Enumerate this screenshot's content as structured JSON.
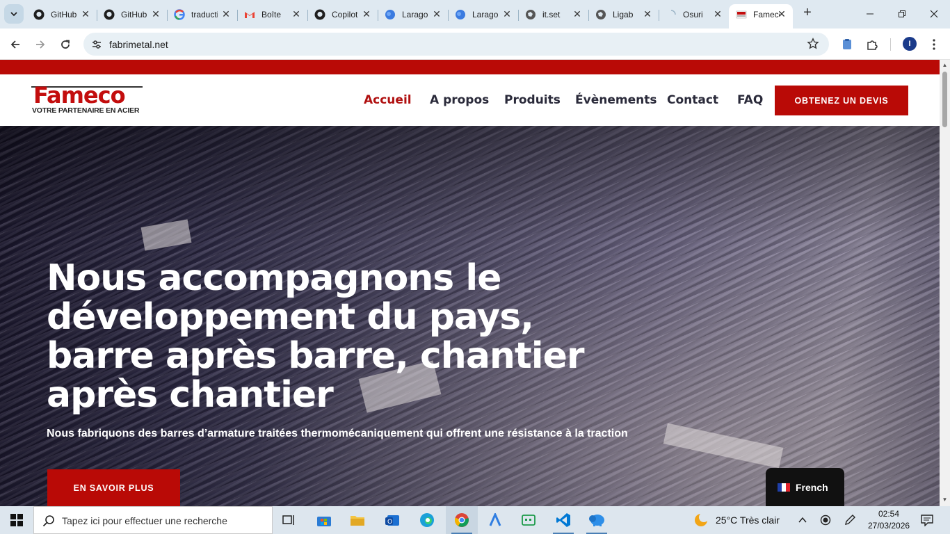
{
  "browser": {
    "tabs": [
      {
        "label": "GitHub",
        "icon": "github-icon"
      },
      {
        "label": "GitHub",
        "icon": "github-icon"
      },
      {
        "label": "traduction",
        "icon": "google-icon"
      },
      {
        "label": "Boîte",
        "icon": "gmail-icon"
      },
      {
        "label": "Copilot",
        "icon": "github-icon"
      },
      {
        "label": "Laragon",
        "icon": "laragon-icon"
      },
      {
        "label": "Laragon",
        "icon": "laragon-icon"
      },
      {
        "label": "it.set",
        "icon": "globe-icon"
      },
      {
        "label": "Ligab",
        "icon": "globe-icon"
      },
      {
        "label": "Osuri",
        "icon": "loading-icon"
      },
      {
        "label": "Fameco",
        "icon": "fameco-favicon",
        "active": true
      }
    ],
    "url": "fabrimetal.net",
    "profile_initial": "I"
  },
  "site": {
    "logo_word": "Fameco",
    "logo_tagline": "VOTRE PARTENAIRE EN ACIER",
    "nav": {
      "home": "Accueil",
      "about": "A propos",
      "products": "Produits",
      "events": "Évènements",
      "contact": "Contact",
      "faq": "FAQ"
    },
    "quote_button": "OBTENEZ UN DEVIS",
    "hero_title": "Nous accompagnons le développement du pays, barre après barre, chantier après chantier",
    "hero_subtitle": "Nous fabriquons des barres d’armature traitées thermomécaniquement qui offrent une résistance à la traction",
    "more_button": "EN SAVOIR PLUS",
    "language": "French",
    "colors": {
      "brand_red": "#b90a06",
      "nav_text": "#2a2a3a"
    }
  },
  "taskbar": {
    "search_placeholder": "Tapez ici pour effectuer une recherche",
    "weather": "25°C  Très clair",
    "time": "02:54",
    "date": "27/03/2026"
  }
}
